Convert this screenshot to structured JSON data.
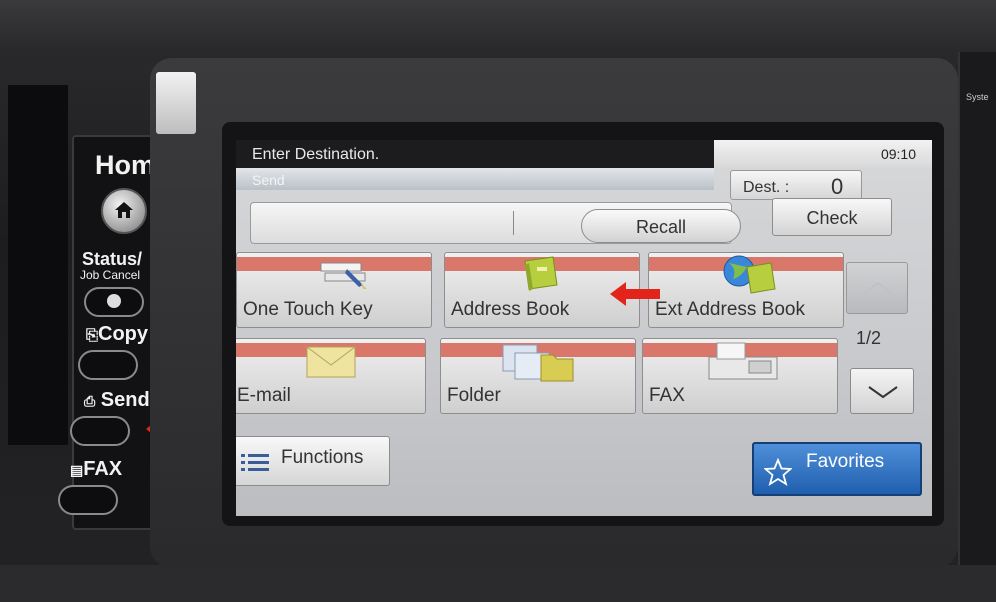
{
  "keys": {
    "home_label": "Home",
    "status_label": "Status/",
    "status_sub": "Job Cancel",
    "copy_label": "Copy",
    "send_label": "Send",
    "fax_label": "FAX"
  },
  "side_panel": {
    "label": "Syste"
  },
  "screen": {
    "title": "Enter Destination.",
    "mode": "Send",
    "clock": "09:10",
    "dest_label": "Dest. :",
    "dest_count": "0",
    "recall_label": "Recall",
    "check_label": "Check",
    "tiles": [
      {
        "label": "One Touch Key"
      },
      {
        "label": "Address Book"
      },
      {
        "label": "Ext Address Book"
      },
      {
        "label": "E-mail"
      },
      {
        "label": "Folder"
      },
      {
        "label": "FAX"
      }
    ],
    "page_indicator": "1/2",
    "functions_label": "Functions",
    "favorites_label": "Favorites"
  },
  "colors": {
    "annotation_arrow": "#e3241b",
    "favorites_blue": "#2e6fc1",
    "tile_stripe": "#d9786a"
  },
  "icons": [
    "home-icon",
    "status-icon",
    "copy-icon",
    "send-icon",
    "fax-icon",
    "one-touch-key-icon",
    "address-book-icon",
    "globe-book-icon",
    "envelope-icon",
    "folder-icon",
    "fax-machine-icon",
    "chevron-up-icon",
    "chevron-down-icon",
    "list-icon",
    "star-icon"
  ]
}
